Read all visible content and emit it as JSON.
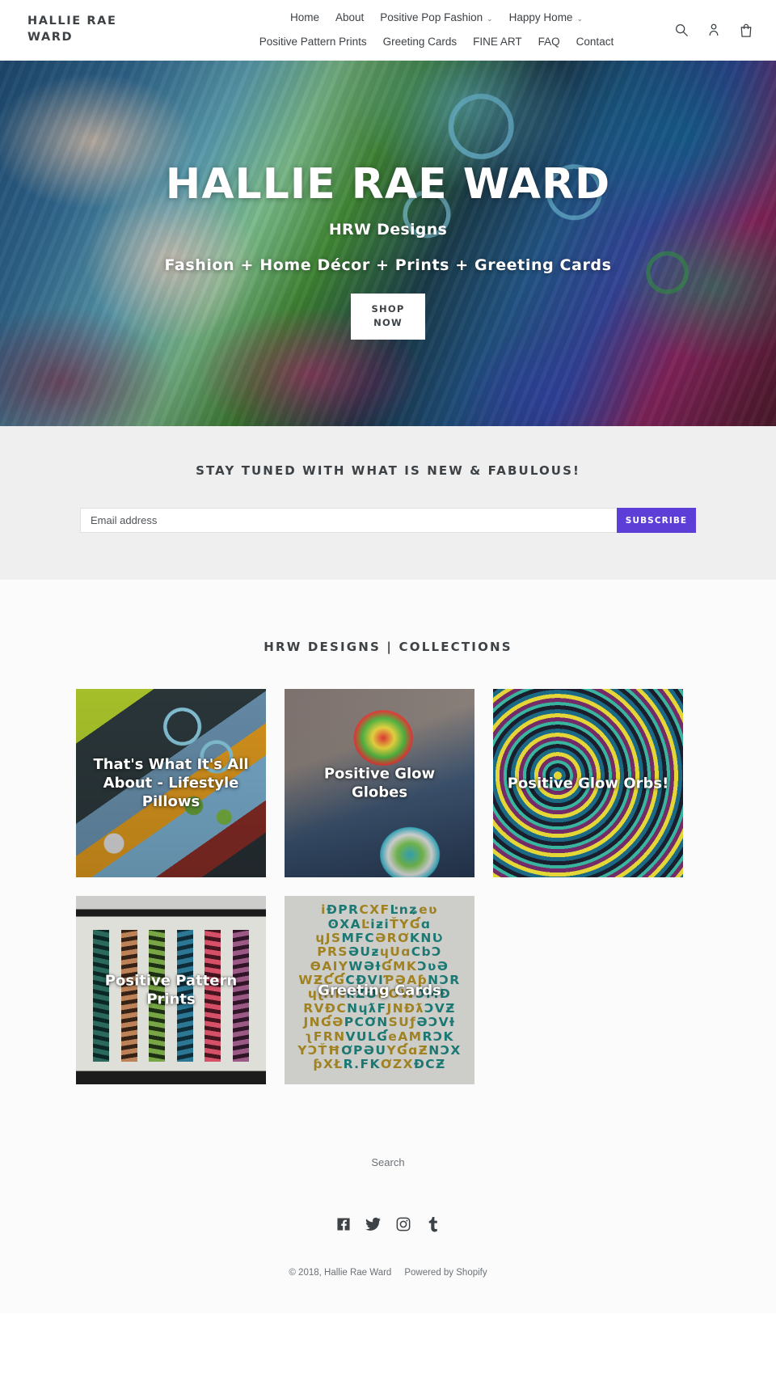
{
  "header": {
    "logo_line1": "HALLIE RAE",
    "logo_line2": "WARD",
    "nav_row1": [
      {
        "label": "Home",
        "caret": ""
      },
      {
        "label": "About",
        "caret": ""
      },
      {
        "label": "Positive Pop Fashion",
        "caret": "⌄"
      },
      {
        "label": "Happy Home",
        "caret": "⌄"
      }
    ],
    "nav_row2": [
      {
        "label": "Positive Pattern Prints",
        "caret": ""
      },
      {
        "label": "Greeting Cards",
        "caret": ""
      },
      {
        "label": "FINE ART",
        "caret": ""
      },
      {
        "label": "FAQ",
        "caret": ""
      },
      {
        "label": "Contact",
        "caret": ""
      }
    ],
    "icons": [
      "search-icon",
      "account-icon",
      "cart-icon"
    ]
  },
  "hero": {
    "title": "HALLIE RAE WARD",
    "subtitle": "HRW Designs",
    "tagline": "Fashion + Home Décor + Prints + Greeting Cards",
    "button_line1": "SHOP",
    "button_line2": "NOW"
  },
  "newsletter": {
    "title": "STAY TUNED WITH WHAT IS NEW & FABULOUS!",
    "placeholder": "Email address",
    "value": "",
    "button": "SUBSCRIBE",
    "button_color": "#5d3fd8",
    "background": "#efefef"
  },
  "collections": {
    "title": "HRW DESIGNS | COLLECTIONS",
    "cards": [
      {
        "label": "That's What It's All About - Lifestyle Pillows",
        "art": "pillows"
      },
      {
        "label": "Positive Glow Globes",
        "art": "globes"
      },
      {
        "label": "Positive Glow Orbs!",
        "art": "orbs"
      },
      {
        "label": "Positive Pattern Prints",
        "art": "prints"
      },
      {
        "label": "Greeting Cards",
        "art": "cards"
      }
    ]
  },
  "footer": {
    "search_link": "Search",
    "social": [
      {
        "name": "facebook-icon"
      },
      {
        "name": "twitter-icon"
      },
      {
        "name": "instagram-icon"
      },
      {
        "name": "tumblr-icon"
      }
    ],
    "copyright": "© 2018, Hallie Rae Ward",
    "powered_by": "Powered by Shopify"
  }
}
